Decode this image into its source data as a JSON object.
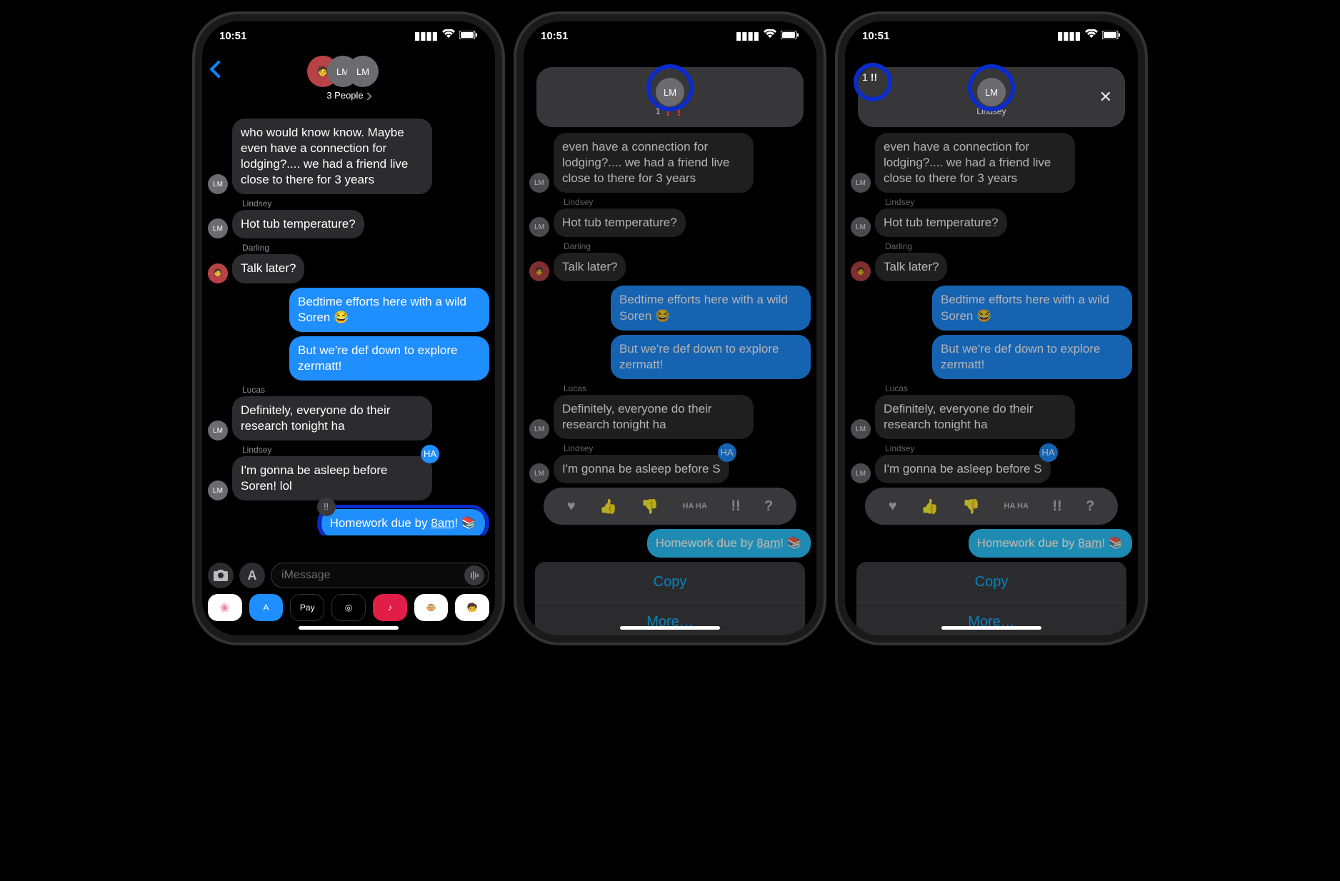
{
  "status": {
    "time": "10:51"
  },
  "screen1": {
    "conv_title": "3 People",
    "avatar_labels": [
      "LM",
      "LM"
    ],
    "messages": {
      "m1": "who would know know.  Maybe even have a connection for lodging?.... we had a friend live close to there for 3 years",
      "m2_sender": "Lindsey",
      "m2": "Hot tub temperature?",
      "m3_sender": "Darling",
      "m3": "Talk later?",
      "m4": "Bedtime efforts here with a wild Soren 😂",
      "m5": "But we're def down to explore zermatt!",
      "m6_sender": "Lucas",
      "m6": "Definitely, everyone do their research tonight ha",
      "m7_sender": "Lindsey",
      "m7": "I'm gonna be asleep before Soren! lol",
      "m8_pre": "Homework due by ",
      "m8_time": "8am",
      "m8_post": "! 📚"
    },
    "compose": {
      "placeholder": "iMessage",
      "apps": {
        "apple_pay": "Pay"
      }
    }
  },
  "screen2": {
    "header": {
      "avatar": "LM",
      "sub_count": "1"
    },
    "messages": {
      "m0": "even have a connection for lodging?.... we had a friend live close to there for 3 years",
      "m2_sender": "Lindsey",
      "m2": "Hot tub temperature?",
      "m3_sender": "Darling",
      "m3": "Talk later?",
      "m4": "Bedtime efforts here with a wild Soren 😂",
      "m5": "But we're def down to explore zermatt!",
      "m6_sender": "Lucas",
      "m6": "Definitely, everyone do their research tonight ha",
      "m7_sender": "Lindsey",
      "m7": "I'm gonna be asleep before S",
      "m8_pre": "Homework due by ",
      "m8_time": "8am",
      "m8_post": "! 📚"
    },
    "tapbacks": {
      "heart": "♥",
      "thumbs_up": "👍",
      "thumbs_down": "👎",
      "haha": "HA HA",
      "exclaim": "!!",
      "question": "?"
    },
    "sheet": {
      "copy": "Copy",
      "more": "More…"
    }
  },
  "screen3": {
    "header": {
      "avatar": "LM",
      "name": "Lindsey"
    },
    "side": {
      "count": "1",
      "icon": "!!"
    }
  }
}
